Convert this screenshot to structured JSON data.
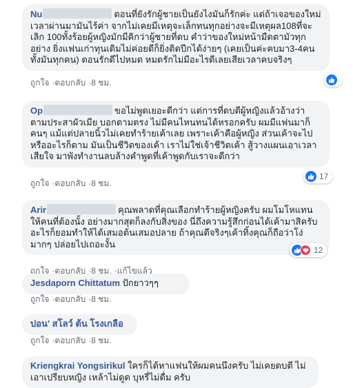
{
  "comments": [
    {
      "author": "Nu",
      "text": "ตอนที่ยังรักผู้ชายเป็นยังไงมันก็รักค่ะ แต่ถ้าเจอของใหม่เวลาผ่านมามันไร้ค่า จากไม่เคยมีเหตุจะเล็กทนทุกอย่างจะมีเหตุผล108ที่จะเลิก 100ทั้งร้อยผู้หญิงมักมีคิกว่าผู้ชายที่ดบ คำว่าของใหม่หน้ามืดตามัวทุกอย่าง ยิ่งแฟนเก่าทุนเดิมไม่ค่อยดีก็ยิ่งติดปีกได้ง่ายๆ (เคยเป็นค่ะคบมา3-4คน ทั้งมันทุกคน) ตอนรักดีไปหมด หมดรักไม่มีอะไรดีเลยเสียเวลาคบจริงๆ",
      "like": "ถูกใจ",
      "reply": "ตอบกลับ",
      "time": "8 ชม.",
      "reactions": ""
    },
    {
      "author": "Op",
      "text": "ขอไม่พูดเยอะดีกว่า แต่การที่ดบตีผู้หญิงแล้วอ้างว่า ตามประสาผัวเมีย บอกตามตรง ไม่มีคนไหนทนได้หรอกครับ ผมมีแฟนมาก็คนๆ แม้แต่ปลายนิ้วไม่เคยทำร้ายเค้าเลย เพราะเค้าคือผู้หญิง ส่วนเค้าจะไปหรืออะไรก็ตาม มันเป็นชีวิตของเค้า เราไม่ใช่เจ้าชีวิตเค้า สู้วางแผนเอาเวลาเสียใจ มาพังทำงานลบล้างคำพูดที่เค้าพูดกับเราจะดีกว่า",
      "like": "ถูกใจ",
      "reply": "ตอบกลับ",
      "time": "8 ชม.",
      "reactions": "17"
    },
    {
      "author": "Arir",
      "text": "คุณพลาดที่คุณเลือกทำร้ายผู้หญิงครับ ผมโมโหแทนให้คนที่ต้องนั้ง อย่างมากสุดก็ลงกับสิ่งของ นี่ถึงความรู้สึกก่อนได้เค้ามาสิครับ อะไรก็ยอมทำให้ได้เสมอต้นเสมอปลาย ถ้าคุณดีจริงๆเค้าทิ้งคุณก็ถือว่าโง่มากๆ ปล่อยไปเถอะงั้น",
      "like": "ถูกใจ",
      "reply": "ตอบกลับ",
      "time": "8 ชม.",
      "edited": "แก้ไขแล้ว",
      "reactions": "12"
    },
    {
      "author": "Jesdaporn Chittatum",
      "text": "ปักยาวๆๆ",
      "like": "ถูกใจ",
      "reply": "ตอบกลับ",
      "time": "8 ชม."
    },
    {
      "author": "ปอน' สโลว์ ต้น โรงเกลือ",
      "text": "",
      "like": "ถูกใจ",
      "reply": "ตอบกลับ",
      "time": "8 ชม."
    },
    {
      "author": "Kriengkrai Yongsirikul",
      "text": "ใครก็ได้หาแฟนให้ผมคนนึงครับ ไม่เคยดบตี ไม่เอาเปรียบหญิง เหล้าไม่ดูด บุหรี่ไม่ดื่ม ครับ"
    }
  ],
  "colors": {
    "bubble": "#f2f3f5",
    "author": "#385898",
    "meta": "#606770",
    "like_blue": "#1877f2",
    "love_red": "#f33e58"
  }
}
